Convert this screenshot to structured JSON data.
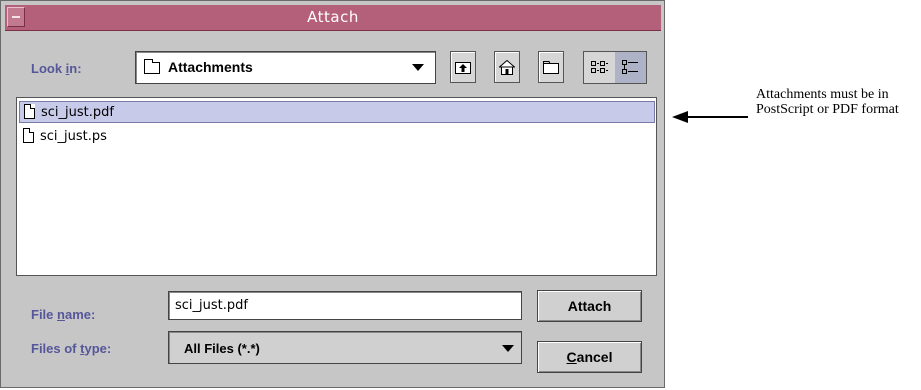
{
  "dialog": {
    "title": "Attach",
    "look_in": {
      "label_pre": "Look ",
      "label_mnemonic": "i",
      "label_post": "n:",
      "value": "Attachments"
    },
    "toolbar": {
      "icons": [
        "up-folder-icon",
        "home-icon",
        "new-folder-icon",
        "list-view-icon",
        "details-view-icon"
      ]
    },
    "files": [
      {
        "name": "sci_just.pdf",
        "selected": true
      },
      {
        "name": "sci_just.ps",
        "selected": false
      }
    ],
    "file_name": {
      "label_pre": "File ",
      "label_mnemonic": "n",
      "label_post": "ame:",
      "value": "sci_just.pdf"
    },
    "file_type": {
      "label_pre": "Files of ",
      "label_mnemonic": "t",
      "label_post": "ype:",
      "value": "All Files (*.*)"
    },
    "buttons": {
      "attach": "Attach",
      "cancel_mnemonic": "C",
      "cancel_rest": "ancel"
    }
  },
  "annotation": {
    "text": "Attachments must be in PostScript or PDF format"
  },
  "colors": {
    "titlebar": "#b4607a",
    "label": "#56569a",
    "selection": "#c8caea",
    "dialog_bg": "#c6c6c6"
  }
}
